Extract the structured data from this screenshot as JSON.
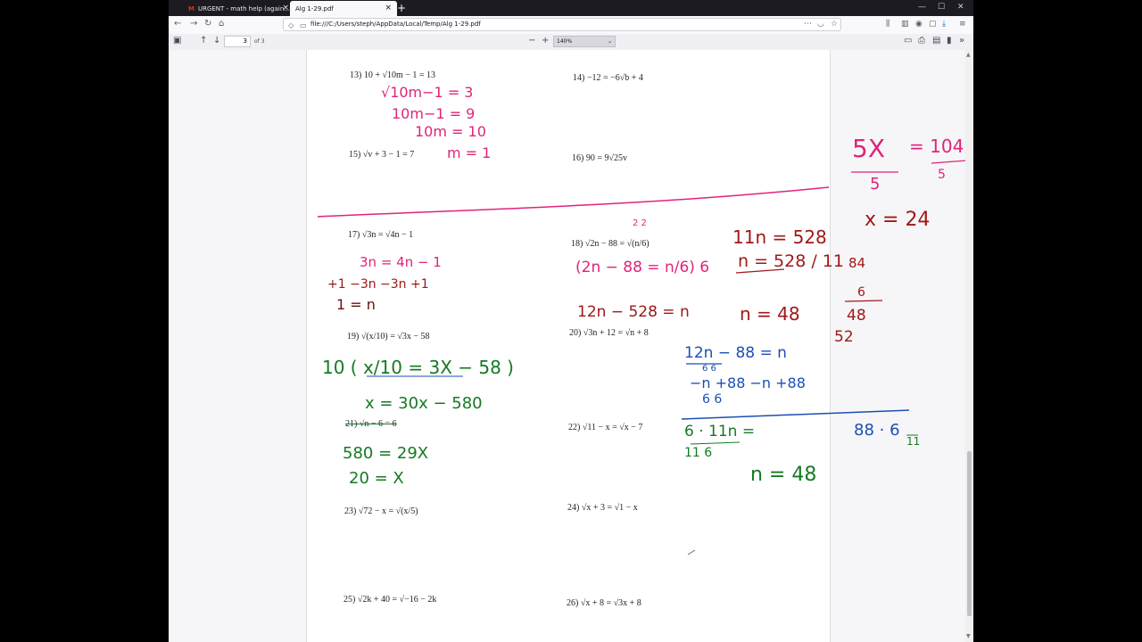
{
  "browser": {
    "tabs": [
      {
        "label": "URGENT - math help (again..."
      },
      {
        "label": "Alg 1-29.pdf"
      }
    ],
    "url": "file:///C:/Users/steph/AppData/Local/Temp/Alg 1-29.pdf"
  },
  "pdf_toolbar": {
    "page_number": "3",
    "page_count": "of 3",
    "zoom": "140%"
  },
  "problems": [
    {
      "id": "p13",
      "text": "13)  10 + √10m − 1 = 13"
    },
    {
      "id": "p14",
      "text": "14)  −12 = −6√b + 4"
    },
    {
      "id": "p15",
      "text": "15)  √v + 3 − 1 = 7"
    },
    {
      "id": "p16",
      "text": "16)  90 = 9√25v"
    },
    {
      "id": "p17",
      "text": "17)  √3n = √4n − 1"
    },
    {
      "id": "p18",
      "text": "18)  √2n − 88 = √(n/6)"
    },
    {
      "id": "p19",
      "text": "19)  √(x/10) = √3x − 58"
    },
    {
      "id": "p20",
      "text": "20)  √3n + 12 = √n + 8"
    },
    {
      "id": "p21",
      "text": "21)  √n − 6 = 6"
    },
    {
      "id": "p22",
      "text": "22)  √11 − x = √x − 7"
    },
    {
      "id": "p23",
      "text": "23)  √72 − x = √(x/5)"
    },
    {
      "id": "p24",
      "text": "24)  √x + 3 = √1 − x"
    },
    {
      "id": "p25",
      "text": "25)  √2k + 40 = √−16 − 2k"
    },
    {
      "id": "p26",
      "text": "26)  √x + 8 = √3x + 8"
    }
  ],
  "handwriting": {
    "h13a": "√10m−1 = 3",
    "h13b": "10m−1 = 9",
    "h13c": "10m = 10",
    "h15": "m = 1",
    "h5x": "5X",
    "h5": "5",
    "h104": "= 104",
    "h104d": "5",
    "hx24": "x = 24",
    "h17a": "3n = 4n − 1",
    "h17b": "+1 −3n     −3n +1",
    "h17c": "1  =  n",
    "h18exp": "2    2",
    "h18a": "(2n − 88 = n/6) 6",
    "h18b": "12n − 528 = n",
    "h11n": "11n = 528",
    "h11b": "n = 528 / 11",
    "h48": "n = 48",
    "h84": "84",
    "h6": "6",
    "h48b": "48",
    "h52": "52",
    "h12n": "12n − 88 = n",
    "h12d": "6                6",
    "h12b": "−n    +88     −n    +88",
    "h12c": "6               6",
    "h19a": "10 ( x/10 = 3X − 58 )",
    "h19b": "x = 30x − 580",
    "h19c": "580 = 29X",
    "h19d": "20 = X",
    "h611": "6 · 11n  =",
    "h611b": "11    6",
    "h886": "88 · 6",
    "h886b": "11",
    "h48g": "n  =  48"
  }
}
